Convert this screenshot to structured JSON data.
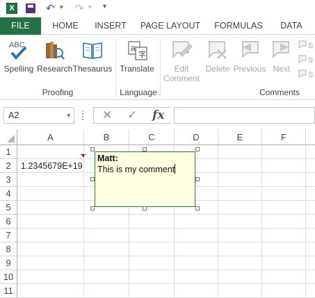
{
  "quick_access": {
    "app_icon": "X"
  },
  "tabs": [
    "FILE",
    "HOME",
    "INSERT",
    "PAGE LAYOUT",
    "FORMULAS",
    "DATA"
  ],
  "ribbon": {
    "proofing": {
      "group": "Proofing",
      "spelling": "Spelling",
      "research": "Research",
      "thesaurus": "Thesaurus",
      "abc": "ABC"
    },
    "language": {
      "group": "Language",
      "translate": "Translate"
    },
    "comments": {
      "group": "Comments",
      "edit_comment_line1": "Edit",
      "edit_comment_line2": "Comment",
      "delete": "Delete",
      "previous": "Previous",
      "next": "Next"
    }
  },
  "formula_bar": {
    "name_box": "A2",
    "fx": "fx",
    "content": ""
  },
  "columns": [
    "A",
    "B",
    "C",
    "D",
    "E",
    "F"
  ],
  "rows": [
    "1",
    "2",
    "3",
    "4",
    "5",
    "6",
    "7",
    "8",
    "9",
    "10",
    "11"
  ],
  "cells": {
    "A2": "1.2345679E+19"
  },
  "comment": {
    "author": "Matt:",
    "text": "This is my comment"
  }
}
